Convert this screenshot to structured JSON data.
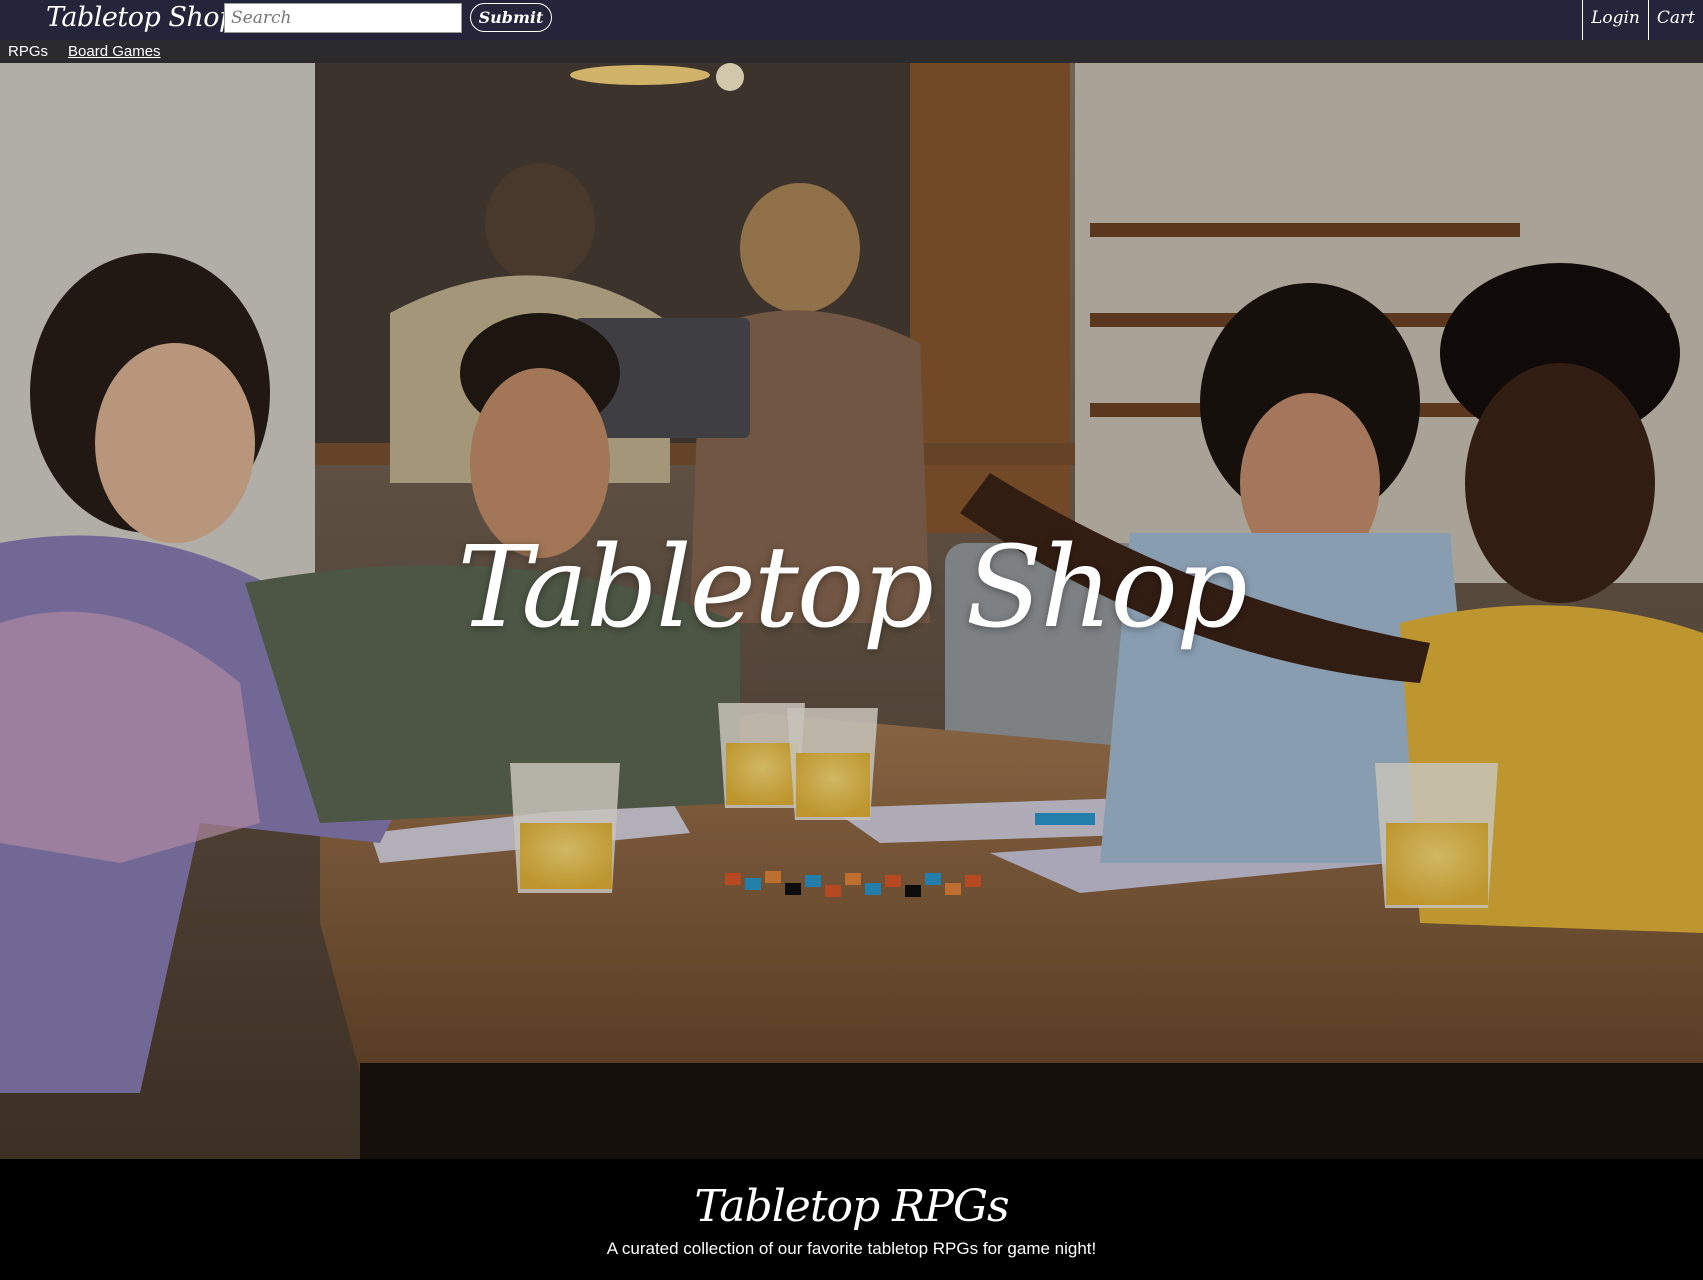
{
  "header": {
    "brand": "Tabletop Shop",
    "search_placeholder": "Search",
    "submit_label": "Submit",
    "login_label": "Login",
    "cart_label": "Cart"
  },
  "subnav": {
    "items": [
      {
        "label": "RPGs"
      },
      {
        "label": "Board Games"
      }
    ]
  },
  "hero": {
    "title": "Tabletop Shop"
  },
  "section": {
    "title": "Tabletop RPGs",
    "description": "A curated collection of our favorite tabletop RPGs for game night!"
  },
  "colors": {
    "topbar": "#24243a",
    "subnav": "#2b2b2e",
    "section_bg": "#000000"
  }
}
